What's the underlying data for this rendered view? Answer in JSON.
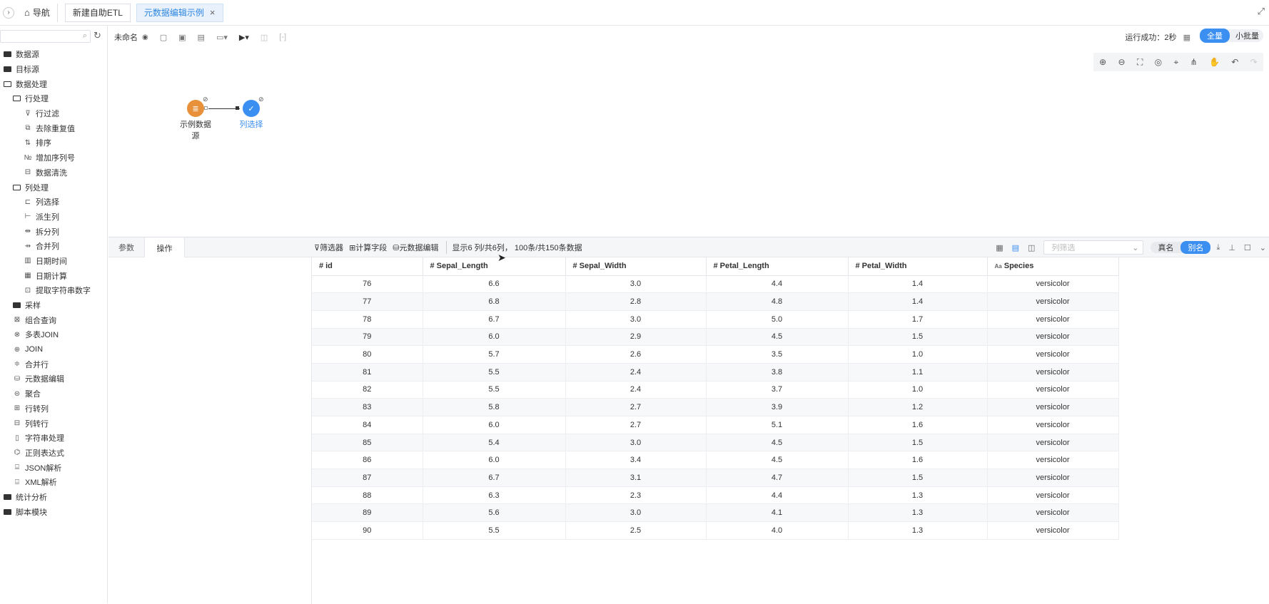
{
  "topbar": {
    "expand_icon": "chevron-right-icon",
    "nav_label": "导航",
    "tabs": [
      {
        "label": "新建自助ETL",
        "active": false
      },
      {
        "label": "元数据编辑示例",
        "active": true
      }
    ]
  },
  "sidebar": {
    "search_placeholder": "",
    "items": [
      {
        "label": "数据源",
        "level": 0,
        "icon": "folder"
      },
      {
        "label": "目标源",
        "level": 0,
        "icon": "folder"
      },
      {
        "label": "数据处理",
        "level": 0,
        "icon": "folder-open"
      },
      {
        "label": "行处理",
        "level": 1,
        "icon": "folder-open"
      },
      {
        "label": "行过滤",
        "level": 2,
        "icon": "filter-icon"
      },
      {
        "label": "去除重复值",
        "level": 2,
        "icon": "dedup-icon"
      },
      {
        "label": "排序",
        "level": 2,
        "icon": "sort-icon"
      },
      {
        "label": "增加序列号",
        "level": 2,
        "icon": "serial-icon"
      },
      {
        "label": "数据清洗",
        "level": 2,
        "icon": "clean-icon"
      },
      {
        "label": "列处理",
        "level": 1,
        "icon": "folder-open"
      },
      {
        "label": "列选择",
        "level": 2,
        "icon": "column-select-icon"
      },
      {
        "label": "派生列",
        "level": 2,
        "icon": "derive-icon"
      },
      {
        "label": "拆分列",
        "level": 2,
        "icon": "split-icon"
      },
      {
        "label": "合并列",
        "level": 2,
        "icon": "merge-icon"
      },
      {
        "label": "日期时间",
        "level": 2,
        "icon": "date-icon"
      },
      {
        "label": "日期计算",
        "level": 2,
        "icon": "date-calc-icon"
      },
      {
        "label": "提取字符串数字",
        "level": 2,
        "icon": "extract-icon"
      },
      {
        "label": "采样",
        "level": 1,
        "icon": "folder"
      },
      {
        "label": "组合查询",
        "level": 1,
        "icon": "query-icon"
      },
      {
        "label": "多表JOIN",
        "level": 1,
        "icon": "multi-join-icon"
      },
      {
        "label": "JOIN",
        "level": 1,
        "icon": "join-icon"
      },
      {
        "label": "合并行",
        "level": 1,
        "icon": "merge-rows-icon"
      },
      {
        "label": "元数据编辑",
        "level": 1,
        "icon": "metadata-icon"
      },
      {
        "label": "聚合",
        "level": 1,
        "icon": "aggregate-icon"
      },
      {
        "label": "行转列",
        "level": 1,
        "icon": "pivot-icon"
      },
      {
        "label": "列转行",
        "level": 1,
        "icon": "unpivot-icon"
      },
      {
        "label": "字符串处理",
        "level": 1,
        "icon": "string-icon"
      },
      {
        "label": "正则表达式",
        "level": 1,
        "icon": "regex-icon"
      },
      {
        "label": "JSON解析",
        "level": 1,
        "icon": "json-icon"
      },
      {
        "label": "XML解析",
        "level": 1,
        "icon": "xml-icon"
      },
      {
        "label": "统计分析",
        "level": 0,
        "icon": "folder"
      },
      {
        "label": "脚本模块",
        "level": 0,
        "icon": "folder"
      }
    ]
  },
  "canvas": {
    "name": "未命名",
    "run_status": "运行成功：2秒",
    "mode_full": "全量",
    "mode_batch": "小批量",
    "nodes": [
      {
        "label": "示例数据源",
        "color": "#e8913a"
      },
      {
        "label": "列选择",
        "color": "#3b8ff0"
      }
    ]
  },
  "bottom": {
    "tab_params": "参数",
    "tab_ops": "操作",
    "tool_filter": "筛选器",
    "tool_calc": "计算字段",
    "tool_meta": "元数据编辑",
    "summary": "显示6 列/共6列，  100条/共150条数据",
    "column_filter_placeholder": "列筛选",
    "real_name": "真名",
    "alias": "别名"
  },
  "table": {
    "columns": [
      {
        "prefix": "#",
        "name": "id"
      },
      {
        "prefix": "#",
        "name": "Sepal_Length"
      },
      {
        "prefix": "#",
        "name": "Sepal_Width"
      },
      {
        "prefix": "#",
        "name": "Petal_Length"
      },
      {
        "prefix": "#",
        "name": "Petal_Width"
      },
      {
        "prefix": "Aa",
        "name": "Species"
      }
    ],
    "rows": [
      [
        "76",
        "6.6",
        "3.0",
        "4.4",
        "1.4",
        "versicolor"
      ],
      [
        "77",
        "6.8",
        "2.8",
        "4.8",
        "1.4",
        "versicolor"
      ],
      [
        "78",
        "6.7",
        "3.0",
        "5.0",
        "1.7",
        "versicolor"
      ],
      [
        "79",
        "6.0",
        "2.9",
        "4.5",
        "1.5",
        "versicolor"
      ],
      [
        "80",
        "5.7",
        "2.6",
        "3.5",
        "1.0",
        "versicolor"
      ],
      [
        "81",
        "5.5",
        "2.4",
        "3.8",
        "1.1",
        "versicolor"
      ],
      [
        "82",
        "5.5",
        "2.4",
        "3.7",
        "1.0",
        "versicolor"
      ],
      [
        "83",
        "5.8",
        "2.7",
        "3.9",
        "1.2",
        "versicolor"
      ],
      [
        "84",
        "6.0",
        "2.7",
        "5.1",
        "1.6",
        "versicolor"
      ],
      [
        "85",
        "5.4",
        "3.0",
        "4.5",
        "1.5",
        "versicolor"
      ],
      [
        "86",
        "6.0",
        "3.4",
        "4.5",
        "1.6",
        "versicolor"
      ],
      [
        "87",
        "6.7",
        "3.1",
        "4.7",
        "1.5",
        "versicolor"
      ],
      [
        "88",
        "6.3",
        "2.3",
        "4.4",
        "1.3",
        "versicolor"
      ],
      [
        "89",
        "5.6",
        "3.0",
        "4.1",
        "1.3",
        "versicolor"
      ],
      [
        "90",
        "5.5",
        "2.5",
        "4.0",
        "1.3",
        "versicolor"
      ]
    ]
  }
}
